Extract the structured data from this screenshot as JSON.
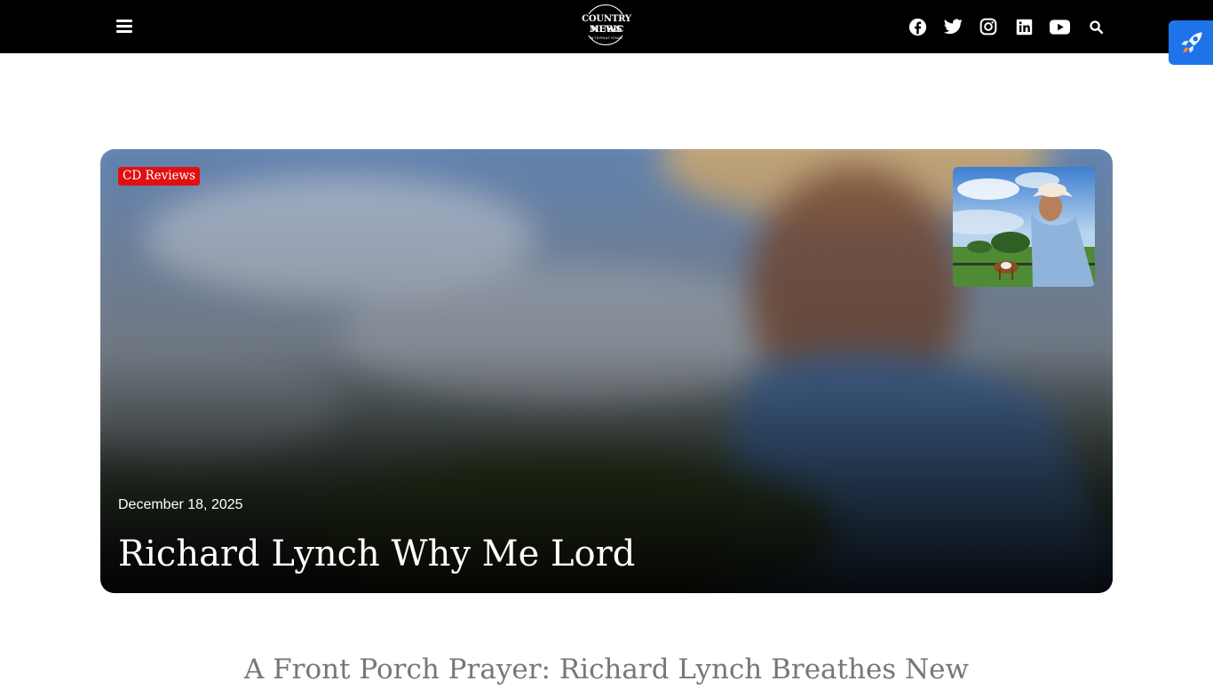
{
  "header": {
    "logo": {
      "line1": "COUNTRY MUSIC",
      "line2": "NEWS",
      "line3": "INTERNATIONAL"
    },
    "menu_icon": "hamburger-menu-icon",
    "social_icons": [
      "facebook-icon",
      "twitter-icon",
      "instagram-icon",
      "linkedin-icon",
      "youtube-icon"
    ],
    "search_icon": "search-icon"
  },
  "floating_button": {
    "icon": "rocket-icon",
    "color": "#1e73e8"
  },
  "featured_post": {
    "category": "CD Reviews",
    "date": "December 18, 2025",
    "title": "Richard Lynch Why Me Lord",
    "badge_color": "#e01010"
  },
  "article": {
    "subheading": "A Front Porch Prayer: Richard Lynch Breathes New"
  }
}
